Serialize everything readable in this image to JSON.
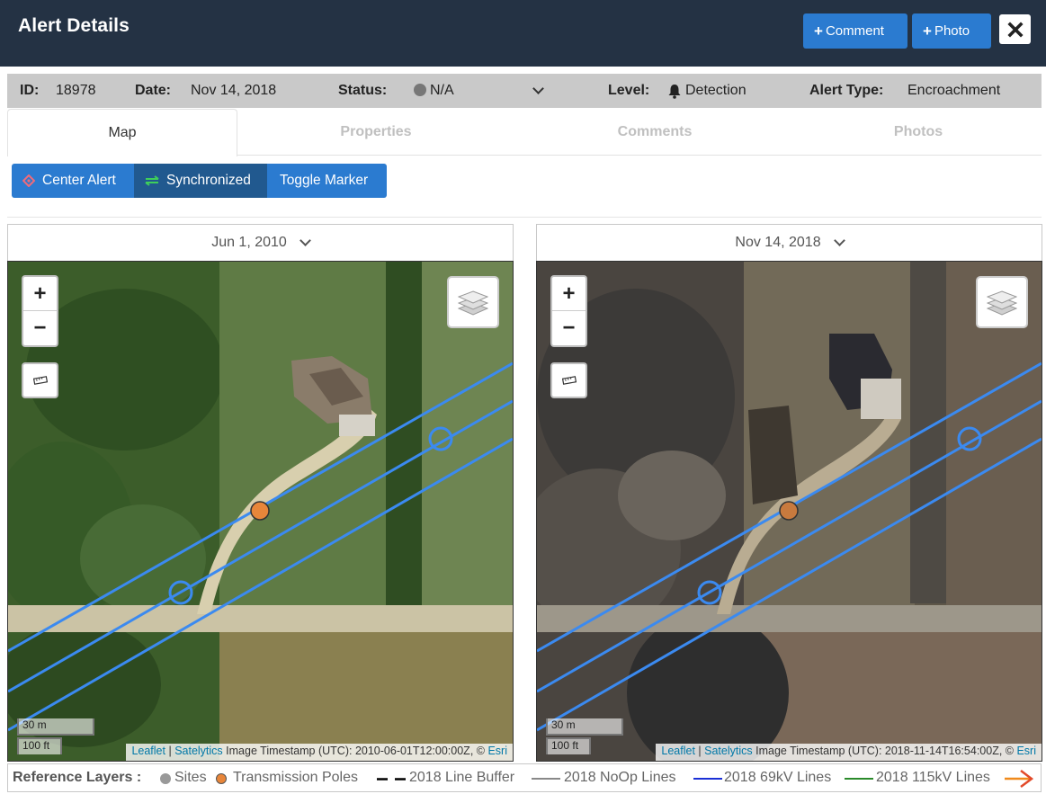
{
  "header": {
    "title": "Alert Details",
    "comment_button": "Comment",
    "photo_button": "Photo"
  },
  "info": {
    "id_label": "ID:",
    "id_value": "18978",
    "date_label": "Date:",
    "date_value": "Nov 14, 2018",
    "status_label": "Status:",
    "status_value": "N/A",
    "level_label": "Level:",
    "level_value": "Detection",
    "type_label": "Alert Type:",
    "type_value": "Encroachment"
  },
  "tabs": [
    {
      "label": "Map",
      "active": true
    },
    {
      "label": "Properties",
      "active": false
    },
    {
      "label": "Comments",
      "active": false
    },
    {
      "label": "Photos",
      "active": false
    }
  ],
  "toolbar": {
    "center_alert": "Center Alert",
    "synchronized": "Synchronized",
    "toggle_marker": "Toggle Marker"
  },
  "maps": {
    "left": {
      "date": "Jun 1, 2010",
      "scale_m": "30 m",
      "scale_ft": "100 ft",
      "attr_leaflet": "Leaflet",
      "attr_satelytics": "Satelytics",
      "attr_text": "Image Timestamp (UTC): 2010-06-01T12:00:00Z, ©",
      "attr_esri": "Esri"
    },
    "right": {
      "date": "Nov 14, 2018",
      "scale_m": "30 m",
      "scale_ft": "100 ft",
      "attr_leaflet": "Leaflet",
      "attr_satelytics": "Satelytics",
      "attr_text": "Image Timestamp (UTC): 2018-11-14T16:54:00Z, ©",
      "attr_esri": "Esri"
    }
  },
  "legend": {
    "title": "Reference Layers :",
    "items": [
      {
        "label": "Sites",
        "color": "#999999"
      },
      {
        "label": "Transmission Poles",
        "color": "#e8863a"
      },
      {
        "label": "2018 Line Buffer",
        "color": "#000000"
      },
      {
        "label": "2018 NoOp Lines",
        "color": "#888888"
      },
      {
        "label": "2018 69kV Lines",
        "color": "#1a2fd6"
      },
      {
        "label": "2018 115kV Lines",
        "color": "#2a8a2a"
      },
      {
        "label": "",
        "color": "#f08a1c"
      }
    ]
  },
  "colors": {
    "header_bg": "#243244",
    "button_blue": "#2b7bd0",
    "button_dark": "#21598f",
    "line_blue": "#3b8af0"
  }
}
